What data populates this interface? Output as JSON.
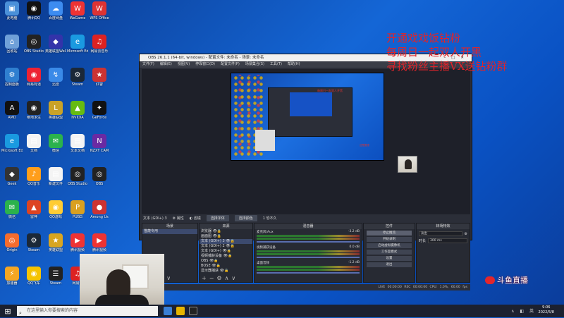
{
  "desktop": {
    "icons": [
      {
        "label": "此电脑",
        "color": "#4a90d9",
        "glyph": "▣"
      },
      {
        "label": "腾讯QQ",
        "color": "#111",
        "glyph": "◉"
      },
      {
        "label": "百度网盘",
        "color": "#3d8cf0",
        "glyph": "☁"
      },
      {
        "label": "WeGame",
        "color": "#e33",
        "glyph": "W"
      },
      {
        "label": "WPS Office",
        "color": "#d33",
        "glyph": "W"
      },
      {
        "label": "回收站",
        "color": "#6fa0d8",
        "glyph": "⌂"
      },
      {
        "label": "OBS Studio",
        "color": "#222",
        "glyph": "◎"
      },
      {
        "label": "英雄联盟WeGame版",
        "color": "#33a",
        "glyph": "◆"
      },
      {
        "label": "Microsoft Edge",
        "color": "#1a9ae0",
        "glyph": "e"
      },
      {
        "label": "网易云音乐",
        "color": "#d22",
        "glyph": "♫"
      },
      {
        "label": "控制面板",
        "color": "#2f7fd0",
        "glyph": "⚙"
      },
      {
        "label": "网易有道",
        "color": "#e23",
        "glyph": "◉"
      },
      {
        "label": "迅雷",
        "color": "#3a8ae8",
        "glyph": "↯"
      },
      {
        "label": "Steam",
        "color": "#1b2838",
        "glyph": "⚙"
      },
      {
        "label": "红警",
        "color": "#c33",
        "glyph": "★"
      },
      {
        "label": "AMD",
        "color": "#111",
        "glyph": "A"
      },
      {
        "label": "绝地求生",
        "color": "#222",
        "glyph": "◉"
      },
      {
        "label": "英雄联盟",
        "color": "#c9a227",
        "glyph": "L"
      },
      {
        "label": "NVIDIA",
        "color": "#6b1",
        "glyph": "▲"
      },
      {
        "label": "GeForce",
        "color": "#111",
        "glyph": "✦"
      },
      {
        "label": "Microsoft Edge",
        "color": "#1a9ae0",
        "glyph": "e"
      },
      {
        "label": "文档",
        "color": "#f4f4f4",
        "glyph": "▤"
      },
      {
        "label": "微信",
        "color": "#2bb24c",
        "glyph": "✉"
      },
      {
        "label": "文本文档",
        "color": "#f4f4f4",
        "glyph": "▤"
      },
      {
        "label": "NZXT CAM",
        "color": "#6a2aa3",
        "glyph": "N"
      },
      {
        "label": "Geek",
        "color": "#333",
        "glyph": "◆"
      },
      {
        "label": "QQ音乐",
        "color": "#ff9e1b",
        "glyph": "♪"
      },
      {
        "label": "新建文件",
        "color": "#f4f4f4",
        "glyph": "▤"
      },
      {
        "label": "OBS Studio",
        "color": "#222",
        "glyph": "◎"
      },
      {
        "label": "OBS",
        "color": "#222",
        "glyph": "◎"
      },
      {
        "label": "微信",
        "color": "#2bb24c",
        "glyph": "✉"
      },
      {
        "label": "雷神",
        "color": "#d42",
        "glyph": "▲"
      },
      {
        "label": "QQ游戏",
        "color": "#fc3",
        "glyph": "◉"
      },
      {
        "label": "PUBG",
        "color": "#d9a020",
        "glyph": "P"
      },
      {
        "label": "Among Us",
        "color": "#c33",
        "glyph": "●"
      },
      {
        "label": "Origin",
        "color": "#f56c2d",
        "glyph": "◎"
      },
      {
        "label": "Steam",
        "color": "#1b2838",
        "glyph": "⚙"
      },
      {
        "label": "英雄联盟",
        "color": "#d8a520",
        "glyph": "★"
      },
      {
        "label": "腾讯视频",
        "color": "#e33",
        "glyph": "▶"
      },
      {
        "label": "腾讯视频",
        "color": "#e33",
        "glyph": "▶"
      },
      {
        "label": "加速器",
        "color": "#f5a623",
        "glyph": "⚡"
      },
      {
        "label": "QQ飞车",
        "color": "#f5c400",
        "glyph": "◉"
      },
      {
        "label": "Steam",
        "color": "#222",
        "glyph": "☰"
      },
      {
        "label": "网易云",
        "color": "#d22",
        "glyph": "♫"
      }
    ]
  },
  "obs": {
    "title": "OBS 26.1.1 (64-bit, windows) - 配置文件: 未命名 - 场景: 未命名",
    "menu": [
      "文件(F)",
      "编辑(E)",
      "视图(V)",
      "停靠窗口(D)",
      "配置文件(P)",
      "场景集合(S)",
      "工具(T)",
      "帮助(H)"
    ],
    "preview_text": "每周日一起双人开黑",
    "preview_text2": "这是置顶",
    "source_bar": {
      "current": "文本 (GDI+) 3",
      "properties": "属性",
      "filters": "滤镜",
      "select_btn1": "选择字体",
      "select_btn2": "选择颜色",
      "size": "1  恐不久"
    },
    "scenes": {
      "title": "场景",
      "items": [
        "猫蔑专用"
      ]
    },
    "sources": {
      "title": "来源",
      "items": [
        "浏览器",
        "画面图",
        "文本 (GDI+) 3",
        "文本 (GDI+) 2",
        "文本 (GDI+)",
        "视频捕获设备",
        "OBS",
        "BOSE",
        "显示器捕获"
      ]
    },
    "mixer": {
      "title": "混音器",
      "tracks": [
        {
          "name": "麦克风/Aux",
          "db": "-3.2 dB"
        },
        {
          "name": "视频捕获设备",
          "db": "0.0 dB"
        },
        {
          "name": "桌面音频",
          "db": "-1.2 dB"
        }
      ]
    },
    "controls": {
      "title": "控件",
      "buttons": [
        "停止推流",
        "开始录制",
        "启动虚拟摄像机",
        "工作室模式",
        "设置",
        "退出"
      ]
    },
    "transitions": {
      "title": "转场特效",
      "type": "淡出",
      "duration_label": "时长",
      "duration": "300 ms"
    },
    "status": "LIVE 00:00:00   REC 00:00:00   CPU: 1.0%, 60.00 fps"
  },
  "overlay": {
    "lines": [
      "开通戏戏饭钻粉",
      "每周日一起双人开黑",
      "寻找粉丝主播VX送钻粉群"
    ],
    "watermark": "斗鱼直播"
  },
  "taskbar": {
    "search_placeholder": "在这里输入你要搜索的内容",
    "time": "9:06",
    "date": "2022/5/8"
  }
}
